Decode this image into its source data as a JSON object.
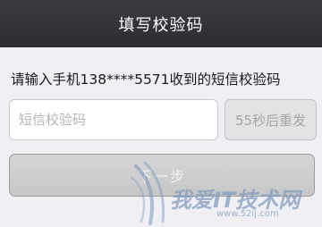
{
  "navbar": {
    "title": "填写校验码"
  },
  "hint": {
    "text": "请输入手机138****5571收到的短信校验码"
  },
  "code_field": {
    "value": "",
    "placeholder": "短信校验码"
  },
  "resend_button": {
    "label": "55秒后重发"
  },
  "next_button": {
    "label": "下一步"
  },
  "watermark": {
    "text": "我爱IT技术网",
    "url": "www.52ij.com"
  },
  "colors": {
    "navbar": "#2f3136",
    "background": "#efeff4",
    "button_disabled": "#cfcfcf"
  }
}
